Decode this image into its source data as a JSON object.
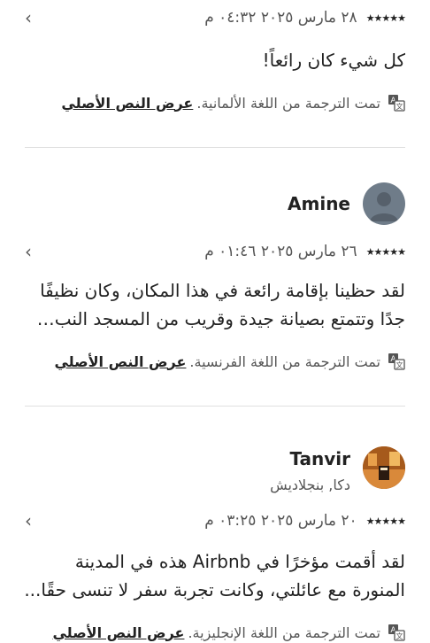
{
  "reviews": [
    {
      "reviewer": "",
      "location": "",
      "rating": 5,
      "stars": "★★★★★",
      "date": "٢٨ مارس ٢٠٢٥ ٠٤:٣٢ م",
      "text_lines": [
        "كل شيء كان رائعاً!"
      ],
      "translated_note": "تمت الترجمة من اللغة الألمانية.",
      "show_original": "عرض النص الأصلي"
    },
    {
      "reviewer": "Amine",
      "location": "",
      "rating": 5,
      "stars": "★★★★★",
      "date": "٢٦ مارس ٢٠٢٥ ٠١:٤٦ م",
      "text_lines": [
        "لقد حظينا بإقامة رائعة في هذا المكان، وكان نظيفًا",
        "جدًا وتتمتع بصيانة جيدة وقريب من المسجد النب…"
      ],
      "translated_note": "تمت الترجمة من اللغة الفرنسية.",
      "show_original": "عرض النص الأصلي"
    },
    {
      "reviewer": "Tanvir",
      "location": "دكا, بنجلاديش",
      "rating": 5,
      "stars": "★★★★★",
      "date": "٢٠ مارس ٢٠٢٥ ٠٣:٢٥ م",
      "text_lines": [
        "لقد أقمت مؤخرًا في Airbnb هذه في المدينة",
        "المنورة مع عائلتي، وكانت تجربة سفر لا تنسى حقًا..."
      ],
      "translated_note": "تمت الترجمة من اللغة الإنجليزية.",
      "show_original": "عرض النص الأصلي"
    }
  ],
  "icons": {
    "chevron": "chevron-left-icon",
    "translate": "translate-icon",
    "avatar_default": "default-avatar-icon"
  }
}
